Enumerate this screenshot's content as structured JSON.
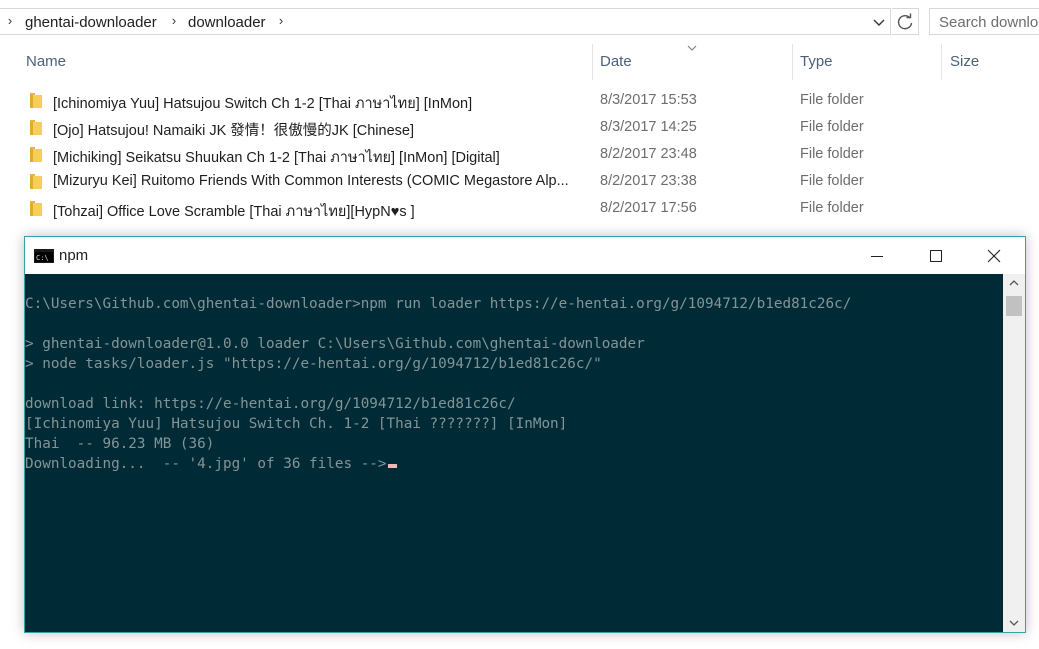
{
  "explorer": {
    "breadcrumb": [
      "ghentai-downloader",
      "downloader"
    ],
    "search_placeholder": "Search downloader",
    "columns": {
      "name": "Name",
      "date": "Date",
      "type": "Type",
      "size": "Size"
    },
    "files": [
      {
        "name": "[Ichinomiya Yuu] Hatsujou Switch Ch 1-2 [Thai ภาษาไทย] [InMon]",
        "date": "8/3/2017 15:53",
        "type": "File folder"
      },
      {
        "name": "[Ojo] Hatsujou! Namaiki JK  發情！很傲慢的JK [Chinese]",
        "date": "8/3/2017 14:25",
        "type": "File folder"
      },
      {
        "name": "[Michiking] Seikatsu Shuukan Ch 1-2 [Thai ภาษาไทย] [InMon] [Digital]",
        "date": "8/2/2017 23:48",
        "type": "File folder"
      },
      {
        "name": "[Mizuryu Kei] Ruitomo  Friends With Common Interests (COMIC Megastore Alp...",
        "date": "8/2/2017 23:38",
        "type": "File folder"
      },
      {
        "name": "[Tohzai] Office Love Scramble  [Thai ภาษาไทย][HypN♥s ]",
        "date": "8/2/2017 17:56",
        "type": "File folder"
      }
    ],
    "folder_color": "#f6cf57"
  },
  "console": {
    "title": "npm",
    "icon": "cmd-icon",
    "background": "#002b36",
    "lines": [
      "C:\\Users\\Github.com\\ghentai-downloader>npm run loader https://e-hentai.org/g/1094712/b1ed81c26c/",
      "",
      "> ghentai-downloader@1.0.0 loader C:\\Users\\Github.com\\ghentai-downloader",
      "> node tasks/loader.js \"https://e-hentai.org/g/1094712/b1ed81c26c/\"",
      "",
      "download link: https://e-hentai.org/g/1094712/b1ed81c26c/",
      "[Ichinomiya Yuu] Hatsujou Switch Ch. 1-2 [Thai ???????] [InMon]",
      "Thai  -- 96.23 MB (36)",
      "Downloading...  -- '4.jpg' of 36 files -->"
    ]
  }
}
